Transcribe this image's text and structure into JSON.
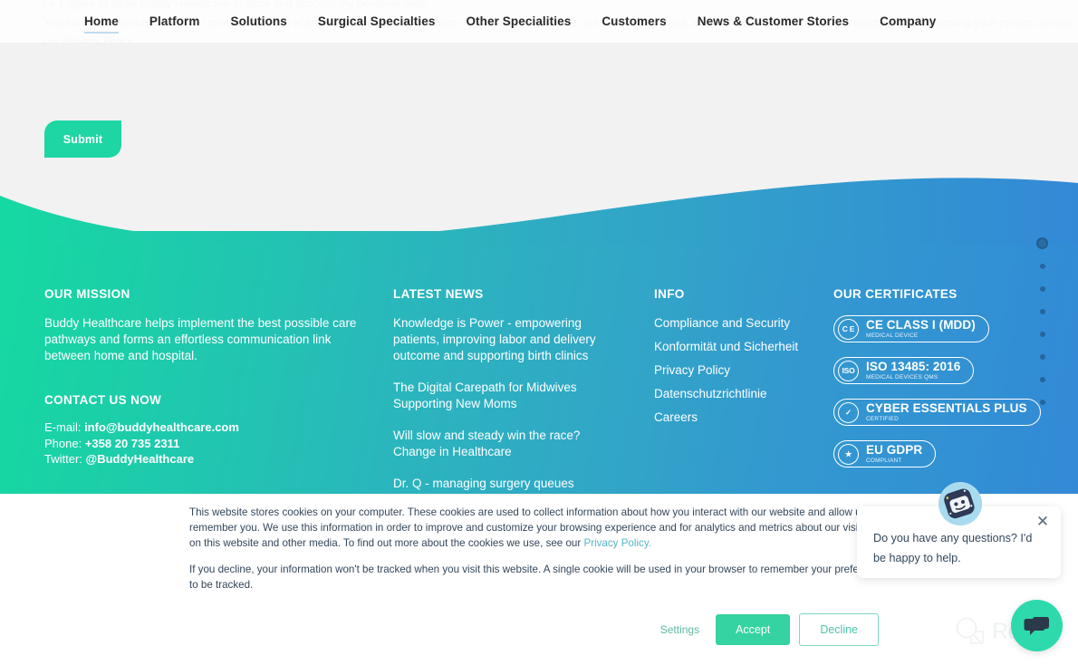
{
  "nav": {
    "items": [
      {
        "label": "Home",
        "active": true
      },
      {
        "label": "Platform",
        "active": false
      },
      {
        "label": "Solutions",
        "active": false
      },
      {
        "label": "Surgical Specialties",
        "active": false
      },
      {
        "label": "Other Specialities",
        "active": false
      },
      {
        "label": "Customers",
        "active": false
      },
      {
        "label": "News & Customer Stories",
        "active": false
      },
      {
        "label": "Company",
        "active": false
      }
    ]
  },
  "hero": {
    "ghost_line_1": "I agree to allow Buddy Healthcare to store and process my personal data.",
    "ghost_line_2_a": "You can unsubscribe from these communications at any time. For more information on how to unsubscribe, our privacy practices, and how we are committed to protecting and respecting your privacy, please review",
    "ghost_line_3_a": "our ",
    "ghost_line_3_link": "Privacy Policy.",
    "submit_label": "Submit"
  },
  "footer": {
    "mission": {
      "title": "OUR MISSION",
      "text": "Buddy Healthcare helps implement the best possible care pathways and forms an effortless communication link between home and hospital.",
      "contact_title": "CONTACT US NOW",
      "email_label": "E-mail: ",
      "email_value": "info@buddyhealthcare.com",
      "phone_label": "Phone: ",
      "phone_value": "+358 20 735 2311",
      "twitter_label": "Twitter: ",
      "twitter_value": "@BuddyHealthcare"
    },
    "news": {
      "title": "LATEST NEWS",
      "items": [
        "Knowledge is Power - empowering patients, improving labor and delivery outcome and supporting birth clinics",
        "The Digital Carepath for Midwives Supporting New Moms",
        "Will slow and steady win the race? Change in Healthcare",
        "Dr. Q - managing surgery queues"
      ]
    },
    "info": {
      "title": "INFO",
      "items": [
        "Compliance and Security",
        "Konformität und Sicherheit",
        "Privacy Policy",
        "Datenschutzrichtlinie",
        "Careers"
      ]
    },
    "certificates": {
      "title": "OUR CERTIFICATES",
      "items": [
        {
          "mark": "C E",
          "main": "CE CLASS I (MDD)",
          "sub": "MEDICAL DEVICE",
          "icon": "ce-mark-icon"
        },
        {
          "mark": "ISO",
          "main": "ISO 13485: 2016",
          "sub": "MEDICAL DEVICES QMS",
          "icon": "iso-mark-icon"
        },
        {
          "mark": "✓",
          "main": "CYBER ESSENTIALS PLUS",
          "sub": "CERTIFIED",
          "icon": "check-mark-icon"
        },
        {
          "mark": "★",
          "main": "EU GDPR",
          "sub": "COMPLIANT",
          "icon": "eu-stars-icon"
        }
      ]
    }
  },
  "dotnav": {
    "count": 8,
    "active_index": 0
  },
  "cookie": {
    "paragraph_1_a": "This website stores cookies on your computer. These cookies are used to collect information about how you interact with our website and allow us to remember you. We use this information in order to improve and customize your browsing experience and for analytics and metrics about our visitors both on this website and other media. To find out more about the cookies we use, see our ",
    "paragraph_1_link": "Privacy Policy.",
    "paragraph_2": "If you decline, your information won't be tracked when you visit this website. A single cookie will be used in your browser to remember your preference not to be tracked.",
    "settings_label": "Settings",
    "accept_label": "Accept",
    "decline_label": "Decline"
  },
  "chat": {
    "message": "Do you have any questions? I'd be happy to help.",
    "close_label": "✕",
    "avatar_name": "bot-avatar-icon",
    "fab_name": "chat-bubble-icon"
  },
  "watermark": {
    "text": "Revain"
  },
  "colors": {
    "accent_green": "#1ed6a4",
    "footer_green": "#16d9a2",
    "footer_blue": "#3389d6",
    "cookie_accept": "#35d3a2",
    "link_blue": "#55b7c7"
  }
}
